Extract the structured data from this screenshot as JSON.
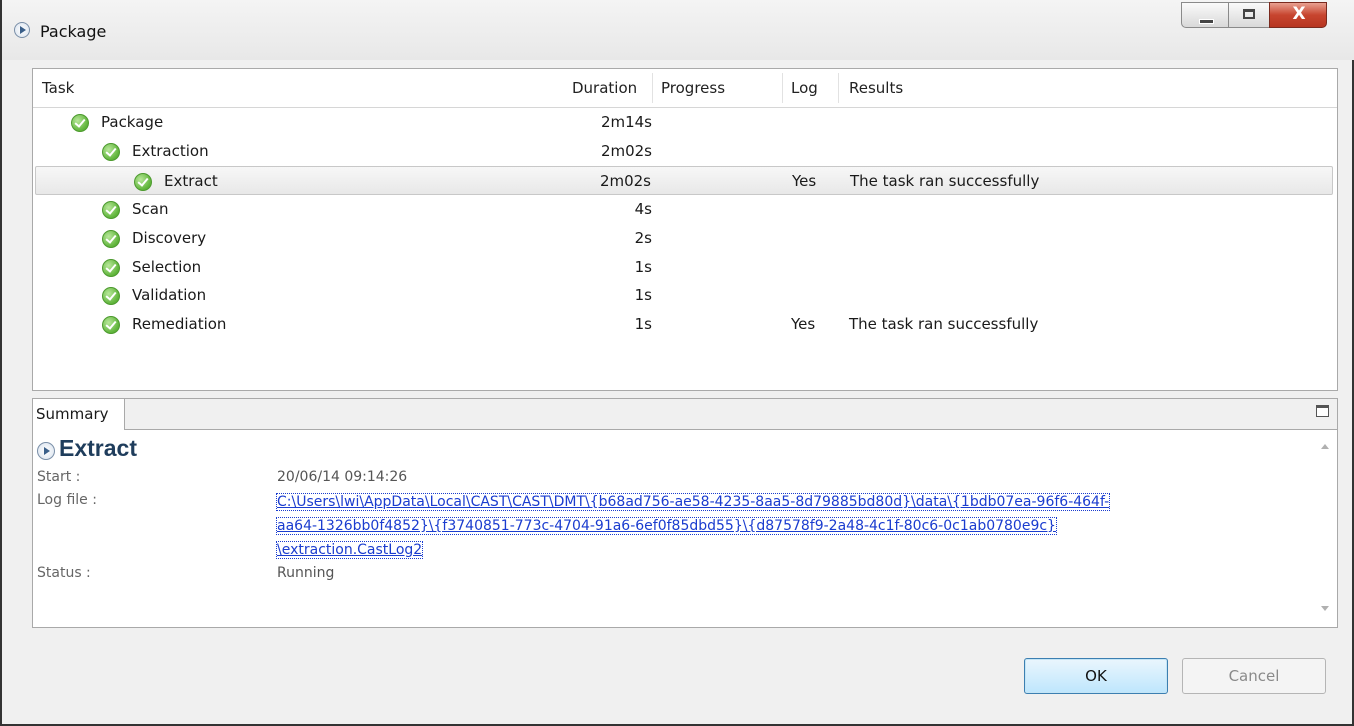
{
  "window": {
    "title": "Package",
    "close_glyph": "X"
  },
  "columns": {
    "task": "Task",
    "duration": "Duration",
    "progress": "Progress",
    "log": "Log",
    "results": "Results"
  },
  "tasks": [
    {
      "name": "Package",
      "duration": "2m14s",
      "log": "",
      "results": ""
    },
    {
      "name": "Extraction",
      "duration": "2m02s",
      "log": "",
      "results": ""
    },
    {
      "name": "Extract",
      "duration": "2m02s",
      "log": "Yes",
      "results": "The task ran successfully"
    },
    {
      "name": "Scan",
      "duration": "4s",
      "log": "",
      "results": ""
    },
    {
      "name": "Discovery",
      "duration": "2s",
      "log": "",
      "results": ""
    },
    {
      "name": "Selection",
      "duration": "1s",
      "log": "",
      "results": ""
    },
    {
      "name": "Validation",
      "duration": "1s",
      "log": "",
      "results": ""
    },
    {
      "name": "Remediation",
      "duration": "1s",
      "log": "Yes",
      "results": "The task ran successfully"
    }
  ],
  "summary": {
    "tab_label": "Summary",
    "title": "Extract",
    "start_label": "Start :",
    "start_value": "20/06/14 09:14:26",
    "logfile_label": "Log file :",
    "logfile_lines": [
      "C:\\Users\\lwi\\AppData\\Local\\CAST\\CAST\\DMT\\{b68ad756-ae58-4235-8aa5-8d79885bd80d}\\data\\{1bdb07ea-96f6-464f-",
      "aa64-1326bb0f4852}\\{f3740851-773c-4704-91a6-6ef0f85dbd55}\\{d87578f9-2a48-4c1f-80c6-0c1ab0780e9c}",
      "\\extraction.CastLog2"
    ],
    "status_label": "Status :",
    "status_value": "Running"
  },
  "buttons": {
    "ok": "OK",
    "cancel": "Cancel"
  },
  "icons": {
    "title": "play-circle-icon",
    "task_status": "check-circle-icon",
    "summary": "play-circle-icon",
    "restore": "restore-icon"
  },
  "colors": {
    "success": "#5fb43a",
    "link": "#1a3ccf",
    "title_accent": "#1f3d5c",
    "close": "#c7452f"
  }
}
